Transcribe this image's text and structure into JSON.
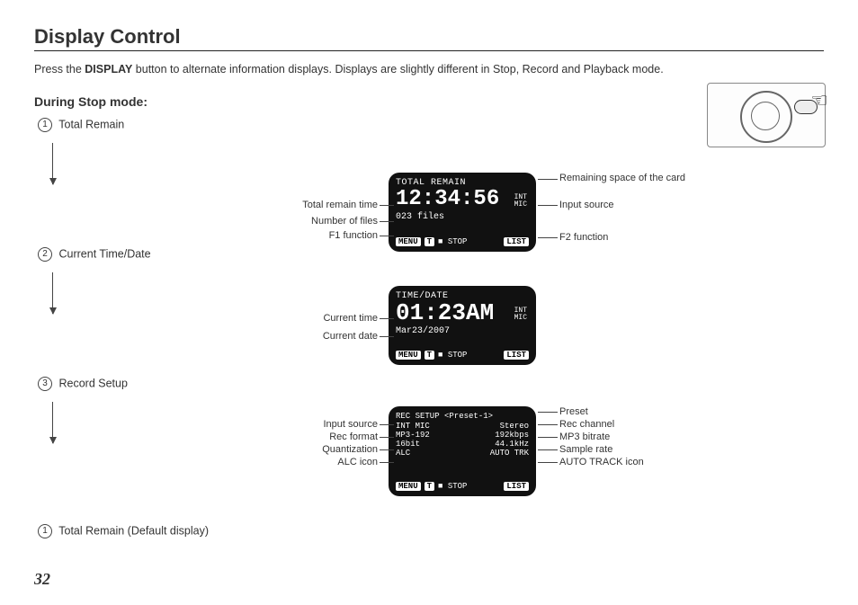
{
  "title": "Display Control",
  "intro": {
    "pre": "Press the ",
    "bold": "DISPLAY",
    "post": " button to alternate information displays. Displays are slightly different in Stop, Record and Playback mode."
  },
  "section": "During Stop mode:",
  "steps": {
    "s1_num": "1",
    "s1_label": "Total Remain",
    "s2_num": "2",
    "s2_label": "Current Time/Date",
    "s3_num": "3",
    "s3_label": "Record Setup",
    "s4_num": "1",
    "s4_label": "Total Remain (Default display)"
  },
  "screen1": {
    "header": "TOTAL REMAIN",
    "time": "12:34:56",
    "side1": "INT",
    "side2": "MIC",
    "files": "023 files",
    "b_menu": "MENU",
    "b_t": "T",
    "b_stop": "■ STOP",
    "b_list": "LIST"
  },
  "screen2": {
    "header": "TIME/DATE",
    "time": "01:23AM",
    "side1": "INT",
    "side2": "MIC",
    "date": "Mar23/2007",
    "b_menu": "MENU",
    "b_t": "T",
    "b_stop": "■ STOP",
    "b_list": "LIST"
  },
  "screen3": {
    "header": "REC SETUP <Preset-1>",
    "l1a": "INT MIC",
    "l1b": "Stereo",
    "l2a": "MP3-192",
    "l2b": "192kbps",
    "l3a": "16bit",
    "l3b": "44.1kHz",
    "l4a": "ALC",
    "l4b": "AUTO TRK",
    "b_menu": "MENU",
    "b_t": "T",
    "b_stop": "■ STOP",
    "b_list": "LIST"
  },
  "labels": {
    "s1_left1": "Total remain time",
    "s1_left2": "Number of files",
    "s1_left3": "F1 function",
    "s1_right1": "Remaining space of the card",
    "s1_right2": "Input source",
    "s1_right3": "F2 function",
    "s2_left1": "Current time",
    "s2_left2": "Current date",
    "s3_left1": "Input source",
    "s3_left2": "Rec format",
    "s3_left3": "Quantization",
    "s3_left4": "ALC icon",
    "s3_right1": "Preset",
    "s3_right2": "Rec channel",
    "s3_right3": "MP3 bitrate",
    "s3_right4": "Sample rate",
    "s3_right5": "AUTO TRACK icon"
  },
  "page": "32"
}
